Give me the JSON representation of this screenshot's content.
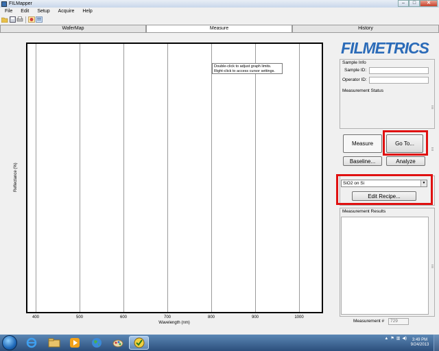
{
  "window": {
    "title": "FILMapper",
    "minimize": "–",
    "maximize": "□",
    "close": "✕"
  },
  "menu": [
    "File",
    "Edit",
    "Setup",
    "Acquire",
    "Help"
  ],
  "toolbar": {
    "icons": [
      "open-folder-icon",
      "save-icon",
      "print-icon",
      "map-icon",
      "report-icon"
    ]
  },
  "tabs": [
    {
      "label": "WaferMap",
      "active": false
    },
    {
      "label": "Measure",
      "active": true
    },
    {
      "label": "History",
      "active": false
    }
  ],
  "graph": {
    "ylabel": "Reflectance (%)",
    "xlabel": "Wavelength (nm)",
    "xticks": [
      "400",
      "500",
      "600",
      "700",
      "800",
      "900",
      "1000"
    ],
    "tooltip_line1": "Double-click to adjust graph limits.",
    "tooltip_line2": "Right-click to access cursor settings."
  },
  "brand": {
    "logo": "FILMETRICS",
    "color": "#2b6bb8"
  },
  "sample_info": {
    "title": "Sample Info",
    "sample_id_label": "Sample ID:",
    "sample_id_value": "",
    "operator_id_label": "Operator ID:",
    "operator_id_value": "",
    "status_title": "Measurement Status"
  },
  "actions": {
    "measure": "Measure",
    "goto": "Go To...",
    "baseline": "Baseline...",
    "analyze": "Analyze"
  },
  "recipe": {
    "selected": "SiO2 on Si",
    "edit": "Edit Recipe..."
  },
  "results": {
    "title": "Measurement Results",
    "meas_label": "Measurement #",
    "meas_value": "729"
  },
  "taskbar": {
    "clock_time": "3:49 PM",
    "clock_date": "9/24/2013",
    "apps": [
      "internet-explorer-icon",
      "file-explorer-icon",
      "media-player-icon",
      "globe-icon",
      "paint-icon",
      "filmapper-icon"
    ]
  },
  "highlight_color": "#e01010"
}
